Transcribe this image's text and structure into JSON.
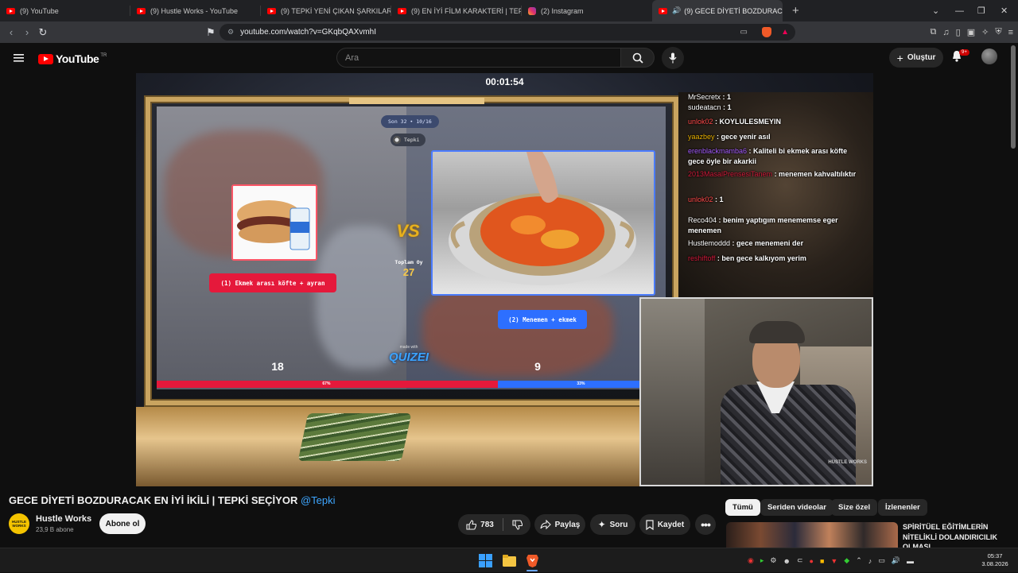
{
  "browser": {
    "tabs": [
      {
        "label": "(9) YouTube",
        "icon": "youtube-favicon",
        "active": false
      },
      {
        "label": "(9) Hustle Works - YouTube",
        "icon": "youtube-favicon",
        "active": false
      },
      {
        "label": "(9) TEPKİ YENİ ÇIKAN ŞARKILARI DİN",
        "icon": "youtube-favicon",
        "active": false
      },
      {
        "label": "(9) EN İYİ FİLM KARAKTERİ | TEPKİ SE",
        "icon": "youtube-favicon",
        "active": false
      },
      {
        "label": "(2) Instagram",
        "icon": "instagram-favicon",
        "active": false
      },
      {
        "label": "(9) GECE DİYETİ BOZDURACA",
        "icon": "youtube-favicon",
        "active": true
      }
    ],
    "url": "youtube.com/watch?v=GKqbQAXvmhI"
  },
  "youtube": {
    "logo_text": "YouTube",
    "region": "TR",
    "search_placeholder": "Ara",
    "create_label": "Oluştur",
    "notification_count": "9+"
  },
  "video": {
    "timer": "00:01:54",
    "quiz": {
      "round": "Son 32 • 10/16",
      "host": "Tepki",
      "left_option": "(1) Ekmek arası köfte + ayran",
      "right_option": "(2) Menemen + ekmek",
      "vs": "VS",
      "total_label": "Toplam Oy",
      "total_votes": "27",
      "made_with": "made with",
      "brand": "QUIZEI",
      "left_votes": "18",
      "right_votes": "9",
      "left_percent": 67,
      "right_percent": 33,
      "left_percent_label": "67%",
      "right_percent_label": "33%"
    },
    "chat": [
      {
        "user": "MrSecretx",
        "msg": "1",
        "color": "#ffffff"
      },
      {
        "user": "sudeatacn",
        "msg": "1",
        "color": "#ffffff"
      },
      {
        "user": "unlok02",
        "msg": "KOYLULESMEYIN",
        "color": "#ff4a4a"
      },
      {
        "user": "yaazbey",
        "msg": "gece yenir asıl",
        "color": "#e8b000"
      },
      {
        "user": "erenblackmamba6",
        "msg": "Kaliteli bi ekmek arası köfte gece öyle bir akarkii",
        "color": "#a55cff"
      },
      {
        "user": "2013MasalPrensesiTanem",
        "msg": "menemen kahvaltılıktır",
        "color": "#d01a3a"
      },
      {
        "user": "unlok02",
        "msg": "1",
        "color": "#ff4a4a"
      },
      {
        "user": "Reco404",
        "msg": "benim yaptıgım menememse eger menemen",
        "color": "#ffffff"
      },
      {
        "user": "Hustlemoddd",
        "msg": "gece menemeni der",
        "color": "#ffffff"
      },
      {
        "user": "reshiftoff",
        "msg": "ben gece kalkıyom yerim",
        "color": "#d01a3a"
      }
    ],
    "watermark": "HUSTLE WORKS"
  },
  "meta": {
    "title": "GECE DİYETİ BOZDURACAK EN İYİ İKİLİ | TEPKİ SEÇİYOR",
    "mention": "@Tepki",
    "channel_name": "Hustle Works",
    "channel_avatar_text": "HUSTLE WORKS",
    "subscribers": "23,9 B abone",
    "subscribe_label": "Abone ol",
    "likes": "783",
    "share_label": "Paylaş",
    "ask_label": "Soru",
    "save_label": "Kaydet"
  },
  "sidebar": {
    "chips": [
      "Tümü",
      "Seriden videolar",
      "Size özel",
      "İzlenenler"
    ],
    "active_chip": "Tümü",
    "recommendation_title": "SPİRİTÜEL EĞİTİMLERİN NİTELİKLİ DOLANDIRICILIK OLMASI"
  },
  "taskbar": {
    "time": "05:37",
    "date": "3.08.2026"
  }
}
